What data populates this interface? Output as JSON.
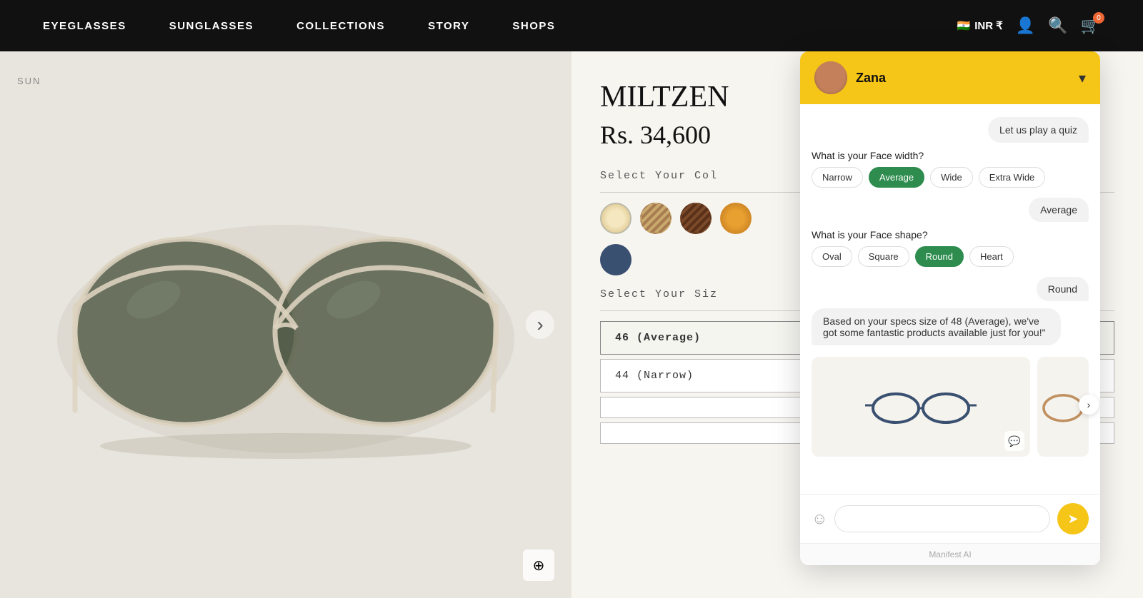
{
  "nav": {
    "links": [
      {
        "id": "eyeglasses",
        "label": "EYEGLASSES"
      },
      {
        "id": "sunglasses",
        "label": "SUNGLASSES"
      },
      {
        "id": "collections",
        "label": "COLLECTIONS"
      },
      {
        "id": "story",
        "label": "STORY"
      },
      {
        "id": "shops",
        "label": "SHOPS"
      }
    ],
    "currency": "INR ₹",
    "cart_count": "0"
  },
  "product": {
    "sun_label": "SUN",
    "title": "MILTZEN",
    "price": "Rs. 34,600",
    "color_section_label": "Select Your Col",
    "size_section_label": "Select Your Siz",
    "sizes": [
      {
        "label": "46 (Average)",
        "selected": true
      },
      {
        "label": "44 (Narrow)",
        "selected": false
      },
      {
        "label": "",
        "selected": false
      },
      {
        "label": "",
        "selected": false
      }
    ]
  },
  "chat": {
    "header": {
      "agent_name": "Zana",
      "chevron": "▾"
    },
    "quiz_button": "Let us play a quiz",
    "messages": [
      {
        "type": "question",
        "text": "What is your Face width?",
        "options": [
          {
            "label": "Narrow",
            "selected": false
          },
          {
            "label": "Average",
            "selected": true
          },
          {
            "label": "Wide",
            "selected": false
          },
          {
            "label": "Extra Wide",
            "selected": false
          }
        ]
      },
      {
        "type": "answer",
        "text": "Average"
      },
      {
        "type": "question",
        "text": "What is your Face shape?",
        "options": [
          {
            "label": "Oval",
            "selected": false
          },
          {
            "label": "Square",
            "selected": false
          },
          {
            "label": "Round",
            "selected": true
          },
          {
            "label": "Heart",
            "selected": false
          }
        ]
      },
      {
        "type": "answer",
        "text": "Round"
      },
      {
        "type": "message",
        "text": "Based on your specs size of 48 (Average), we've got some fantastic products available just for you!\""
      }
    ],
    "footer": "Manifest AI",
    "input_placeholder": "",
    "send_icon": "➤"
  }
}
